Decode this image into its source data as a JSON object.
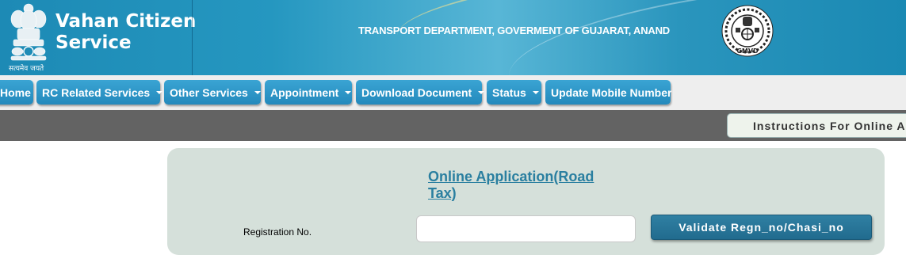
{
  "header": {
    "emblem_tagline": "सत्यमेव जयते",
    "brand_line1": "Vahan Citizen",
    "brand_line2": "Service",
    "department": "TRANSPORT DEPARTMENT, GOVERMENT OF GUJARAT, ANAND",
    "gmvd_logo_text": "GMVD"
  },
  "nav": {
    "items": [
      {
        "label": "Home",
        "dropdown": false
      },
      {
        "label": "RC Related Services",
        "dropdown": true
      },
      {
        "label": "Other Services",
        "dropdown": true
      },
      {
        "label": "Appointment",
        "dropdown": true
      },
      {
        "label": "Download Document",
        "dropdown": true
      },
      {
        "label": "Status",
        "dropdown": true
      },
      {
        "label": "Update Mobile Number",
        "dropdown": false
      }
    ]
  },
  "instructions_button": "Instructions For Online A",
  "form": {
    "title": "Online Application(Road Tax)",
    "registration_label": "Registration No.",
    "registration_value": "",
    "validate_button": "Validate Regn_no/Chasi_no"
  },
  "colors": {
    "header_blue": "#2597c0",
    "nav_button_blue": "#2389bc",
    "panel_bg": "#d5e0da",
    "title_color": "#2a7fa0",
    "validate_button": "#216b8e",
    "grey_bar": "#636363"
  }
}
